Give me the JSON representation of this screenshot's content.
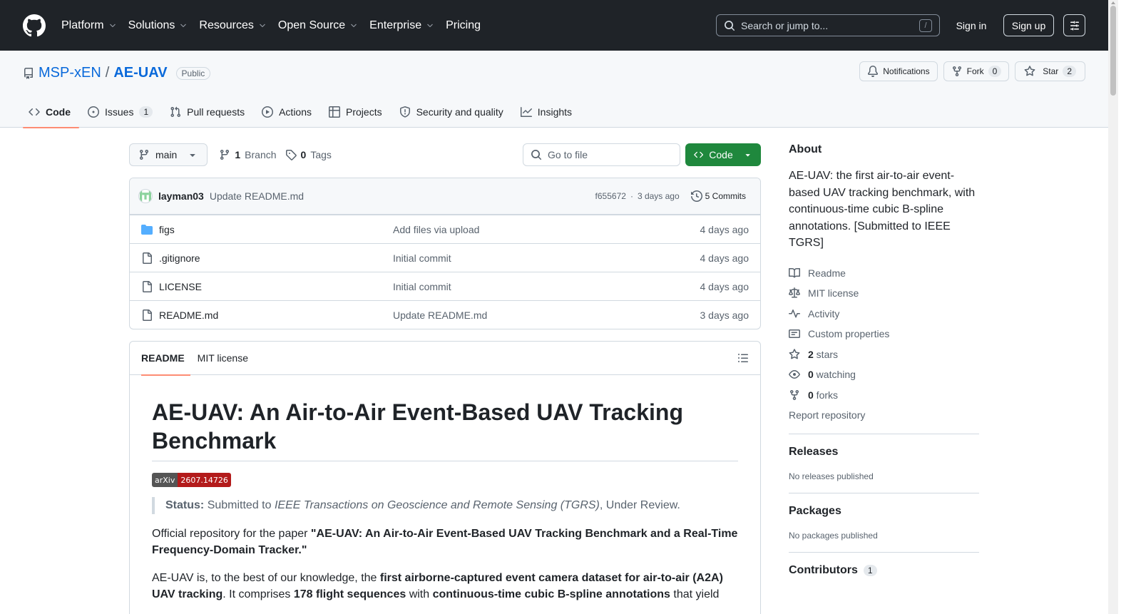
{
  "header": {
    "nav": [
      {
        "label": "Platform",
        "has_menu": true
      },
      {
        "label": "Solutions",
        "has_menu": true
      },
      {
        "label": "Resources",
        "has_menu": true
      },
      {
        "label": "Open Source",
        "has_menu": true
      },
      {
        "label": "Enterprise",
        "has_menu": true
      },
      {
        "label": "Pricing",
        "has_menu": false
      }
    ],
    "search_placeholder": "Search or jump to...",
    "search_shortcut": "/",
    "sign_in": "Sign in",
    "sign_up": "Sign up"
  },
  "repo": {
    "owner": "MSP-xEN",
    "separator": "/",
    "name": "AE-UAV",
    "visibility": "Public",
    "notifications_label": "Notifications",
    "fork_label": "Fork",
    "fork_count": "0",
    "star_label": "Star",
    "star_count": "2"
  },
  "tabs": [
    {
      "label": "Code",
      "icon": "code-icon",
      "active": true
    },
    {
      "label": "Issues",
      "icon": "issue-icon",
      "count": "1"
    },
    {
      "label": "Pull requests",
      "icon": "pull-request-icon"
    },
    {
      "label": "Actions",
      "icon": "play-icon"
    },
    {
      "label": "Projects",
      "icon": "table-icon"
    },
    {
      "label": "Security and quality",
      "icon": "shield-icon"
    },
    {
      "label": "Insights",
      "icon": "graph-icon"
    }
  ],
  "toolbar": {
    "branch": "main",
    "branch_count": "1",
    "branch_label": "Branch",
    "tag_count": "0",
    "tag_label": "Tags",
    "goto_placeholder": "Go to file",
    "code_button": "Code"
  },
  "commit": {
    "author": "layman03",
    "message": "Update README.md",
    "hash": "f655672",
    "dot": "·",
    "time": "3 days ago",
    "commits_label": "5 Commits"
  },
  "files": [
    {
      "type": "folder",
      "name": "figs",
      "message": "Add files via upload",
      "time": "4 days ago"
    },
    {
      "type": "file",
      "name": ".gitignore",
      "message": "Initial commit",
      "time": "4 days ago"
    },
    {
      "type": "file",
      "name": "LICENSE",
      "message": "Initial commit",
      "time": "4 days ago"
    },
    {
      "type": "file",
      "name": "README.md",
      "message": "Update README.md",
      "time": "3 days ago"
    }
  ],
  "readme": {
    "tabs": [
      "README",
      "MIT license"
    ],
    "title": "AE-UAV: An Air-to-Air Event-Based UAV Tracking Benchmark",
    "badge_left": "arXiv",
    "badge_right": "2607.14726",
    "status_label": "Status:",
    "status_glyph": "",
    "status_text": " Submitted to ",
    "status_journal": "IEEE Transactions on Geoscience and Remote Sensing (TGRS)",
    "status_tail": ", Under Review.",
    "p1_text": "Official repository for the paper ",
    "p1_bold": "\"AE-UAV: An Air-to-Air Event-Based UAV Tracking Benchmark and a Real-Time Frequency-Domain Tracker.\"",
    "p2_a": "AE-UAV is, to the best of our knowledge, the ",
    "p2_b": "first airborne-captured event camera dataset for air-to-air (A2A) UAV tracking",
    "p2_c": ". It comprises ",
    "p2_d": "178 flight sequences",
    "p2_e": " with ",
    "p2_f": "continuous-time cubic B-spline annotations",
    "p2_g": " that yield "
  },
  "sidebar": {
    "about_title": "About",
    "description": "AE-UAV: the first air-to-air event-based UAV tracking benchmark, with continuous-time cubic B-spline annotations. [Submitted to IEEE TGRS]",
    "links": [
      {
        "icon": "book-icon",
        "label": "Readme"
      },
      {
        "icon": "law-icon",
        "label": "MIT license"
      },
      {
        "icon": "pulse-icon",
        "label": "Activity"
      },
      {
        "icon": "note-icon",
        "label": "Custom properties"
      },
      {
        "icon": "star-icon",
        "bold": "2",
        "label": " stars"
      },
      {
        "icon": "eye-icon",
        "bold": "0",
        "label": " watching"
      },
      {
        "icon": "fork-icon",
        "bold": "0",
        "label": " forks"
      }
    ],
    "report": "Report repository",
    "releases_title": "Releases",
    "releases_empty": "No releases published",
    "packages_title": "Packages",
    "packages_empty": "No packages published",
    "contributors_title": "Contributors",
    "contributors_count": "1"
  }
}
